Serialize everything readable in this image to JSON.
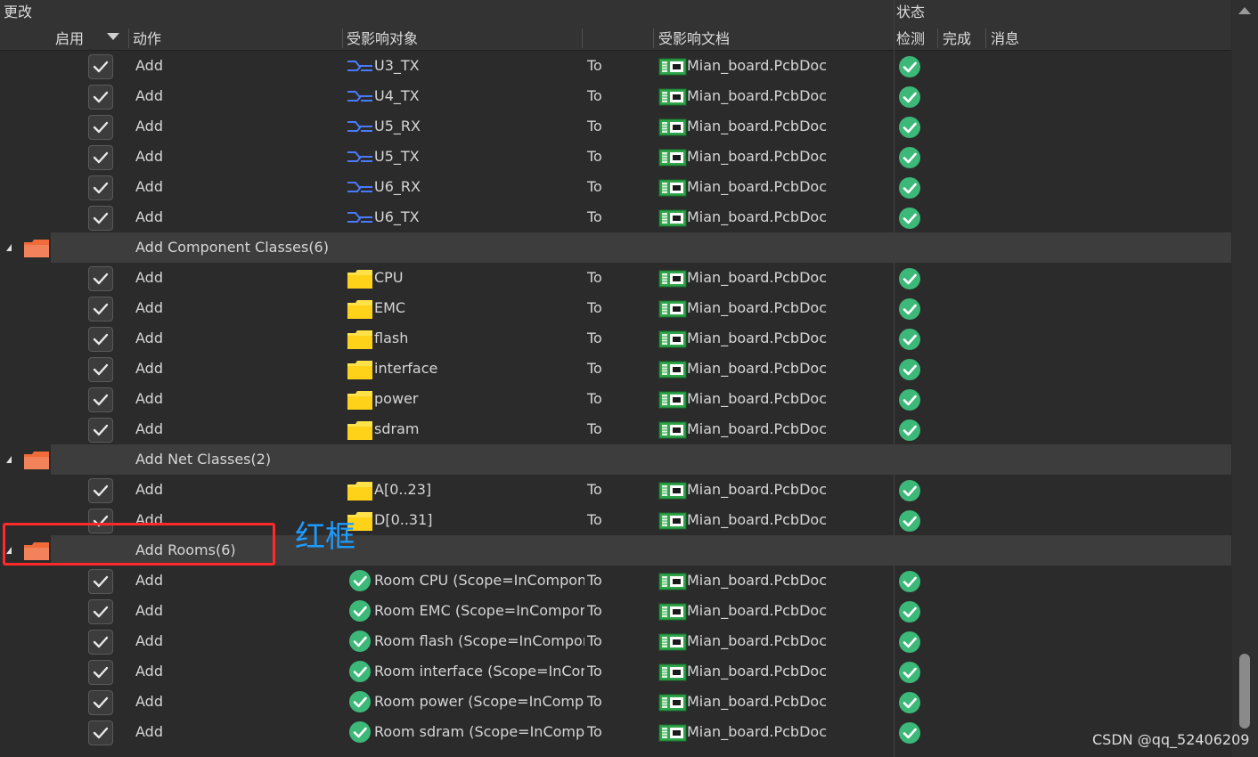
{
  "header": {
    "changes": "更改",
    "status": "状态",
    "enable": "启用",
    "action": "动作",
    "affected_object": "受影响对象",
    "affected_document": "受影响文档",
    "check": "检测",
    "done": "完成",
    "message": "消息"
  },
  "rows": [
    {
      "type": "item",
      "action": "Add",
      "icon": "net-icon",
      "object": "U3_TX",
      "to": "To",
      "doc": "Mian_board.PcbDoc"
    },
    {
      "type": "item",
      "action": "Add",
      "icon": "net-icon",
      "object": "U4_TX",
      "to": "To",
      "doc": "Mian_board.PcbDoc"
    },
    {
      "type": "item",
      "action": "Add",
      "icon": "net-icon",
      "object": "U5_RX",
      "to": "To",
      "doc": "Mian_board.PcbDoc"
    },
    {
      "type": "item",
      "action": "Add",
      "icon": "net-icon",
      "object": "U5_TX",
      "to": "To",
      "doc": "Mian_board.PcbDoc"
    },
    {
      "type": "item",
      "action": "Add",
      "icon": "net-icon",
      "object": "U6_RX",
      "to": "To",
      "doc": "Mian_board.PcbDoc"
    },
    {
      "type": "item",
      "action": "Add",
      "icon": "net-icon",
      "object": "U6_TX",
      "to": "To",
      "doc": "Mian_board.PcbDoc"
    },
    {
      "type": "group",
      "label": "Add Component Classes(6)"
    },
    {
      "type": "item",
      "action": "Add",
      "icon": "folder-icon",
      "object": "CPU",
      "to": "To",
      "doc": "Mian_board.PcbDoc"
    },
    {
      "type": "item",
      "action": "Add",
      "icon": "folder-icon",
      "object": "EMC",
      "to": "To",
      "doc": "Mian_board.PcbDoc"
    },
    {
      "type": "item",
      "action": "Add",
      "icon": "folder-icon",
      "object": "flash",
      "to": "To",
      "doc": "Mian_board.PcbDoc"
    },
    {
      "type": "item",
      "action": "Add",
      "icon": "folder-icon",
      "object": "interface",
      "to": "To",
      "doc": "Mian_board.PcbDoc"
    },
    {
      "type": "item",
      "action": "Add",
      "icon": "folder-icon",
      "object": "power",
      "to": "To",
      "doc": "Mian_board.PcbDoc"
    },
    {
      "type": "item",
      "action": "Add",
      "icon": "folder-icon",
      "object": "sdram",
      "to": "To",
      "doc": "Mian_board.PcbDoc"
    },
    {
      "type": "group",
      "label": "Add Net Classes(2)"
    },
    {
      "type": "item",
      "action": "Add",
      "icon": "folder-icon",
      "object": "A[0..23]",
      "to": "To",
      "doc": "Mian_board.PcbDoc"
    },
    {
      "type": "item",
      "action": "Add",
      "icon": "folder-icon",
      "object": "D[0..31]",
      "to": "To",
      "doc": "Mian_board.PcbDoc"
    },
    {
      "type": "group",
      "label": "Add Rooms(6)"
    },
    {
      "type": "item",
      "action": "Add",
      "icon": "room-check-icon",
      "object": "Room CPU (Scope=InComponentClass('CPU'))",
      "to": "To",
      "doc": "Mian_board.PcbDoc"
    },
    {
      "type": "item",
      "action": "Add",
      "icon": "room-check-icon",
      "object": "Room EMC (Scope=InComponentClass('EMC'))",
      "to": "To",
      "doc": "Mian_board.PcbDoc"
    },
    {
      "type": "item",
      "action": "Add",
      "icon": "room-check-icon",
      "object": "Room flash (Scope=InComponentClass('flash'))",
      "to": "To",
      "doc": "Mian_board.PcbDoc"
    },
    {
      "type": "item",
      "action": "Add",
      "icon": "room-check-icon",
      "object": "Room interface (Scope=InComponentClass('interface'))",
      "to": "To",
      "doc": "Mian_board.PcbDoc"
    },
    {
      "type": "item",
      "action": "Add",
      "icon": "room-check-icon",
      "object": "Room power (Scope=InComponentClass('power'))",
      "to": "To",
      "doc": "Mian_board.PcbDoc"
    },
    {
      "type": "item",
      "action": "Add",
      "icon": "room-check-icon",
      "object": "Room sdram (Scope=InComponentClass('sdram'))",
      "to": "To",
      "doc": "Mian_board.PcbDoc"
    }
  ],
  "annotation": {
    "label": "红框",
    "color": "#1e9bff",
    "box_color": "#ff2b2b"
  },
  "watermark": "CSDN @qq_52406209",
  "colors": {
    "background": "#2b2b2b",
    "group_row": "#3d3d3d",
    "check_green": "#3cb878",
    "folder_yellow": "#ffe14a",
    "folder_orange": "#f06a3a",
    "net_blue": "#4a7bff"
  }
}
